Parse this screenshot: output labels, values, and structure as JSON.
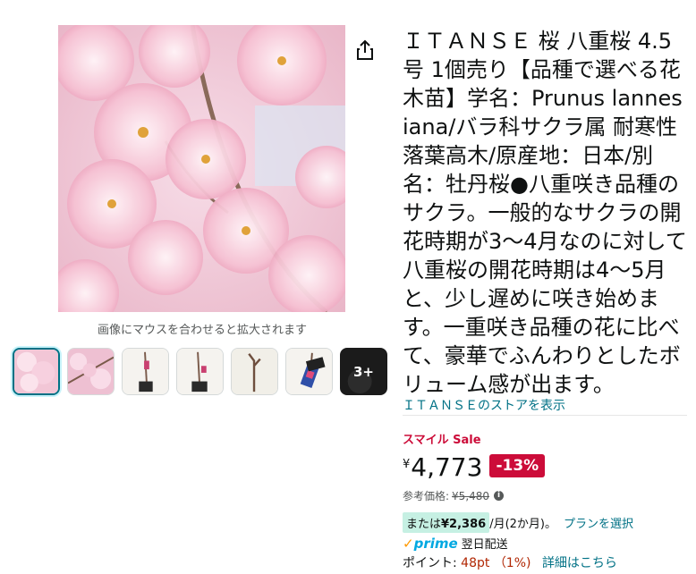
{
  "product": {
    "title": "ＩＴＡＮＳＥ 桜 八重桜 4.5号 1個売り【品種で選べる花木苗】学名：Prunus lannesiana/バラ科サクラ属 耐寒性落葉高木/原産地：日本/別名：牡丹桜●八重咲き品種のサクラ。一般的なサクラの開花時期が3〜4月なのに対して八重桜の開花時期は4〜5月と、少し遅めに咲き始めます。一重咲き品種の花に比べて、豪華でふんわりとしたボリューム感が出ます。",
    "store_link": "ＩＴＡＮＳＥのストアを表示"
  },
  "gallery": {
    "zoom_hint": "画像にマウスを合わせると拡大されます",
    "thumbnails": [
      "cherry-blossom-closeup",
      "cherry-blossom-branch",
      "potted-sapling-1",
      "potted-sapling-2",
      "bare-branch",
      "pot-tag"
    ],
    "more_label": "3+",
    "share_icon": "share-icon"
  },
  "pricing": {
    "sale_label": "スマイル Sale",
    "currency_symbol": "¥",
    "price": "4,773",
    "discount": "-13%",
    "reference_label": "参考価格:",
    "reference_price": "¥5,480",
    "installment_prefix": "または",
    "installment_amount": "¥2,386",
    "installment_suffix": "/月(2か月)。",
    "plan_link": "プランを選択"
  },
  "delivery": {
    "prime": "prime",
    "prime_check": "✓",
    "delivery_text": "翌日配送"
  },
  "points": {
    "label": "ポイント:",
    "value": "48pt （1%)",
    "details_link": "詳細はこちら"
  },
  "colors": {
    "link": "#007185",
    "sale": "#cc0c39",
    "prime": "#00a8e1",
    "highlight": "#c6f0e3"
  }
}
